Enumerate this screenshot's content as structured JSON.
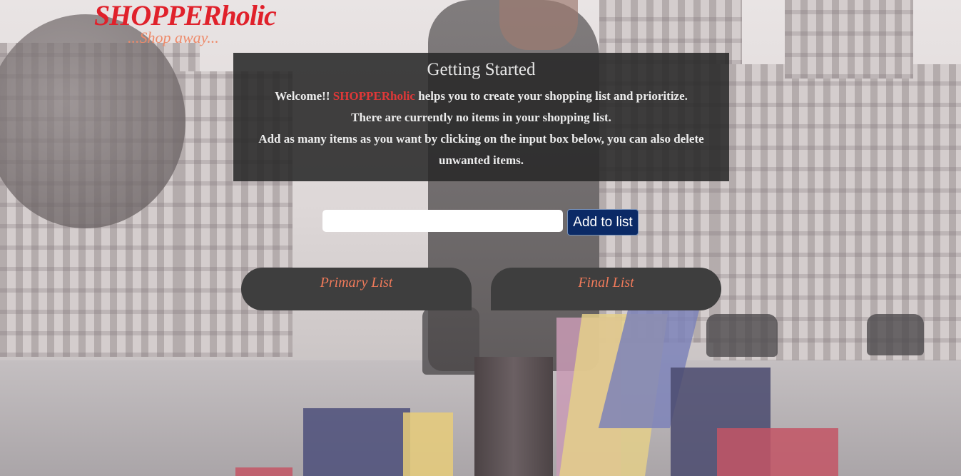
{
  "header": {
    "logo_title": "SHOPPERholic",
    "tagline": "...Shop away..."
  },
  "intro": {
    "heading": "Getting Started",
    "line1_prefix": "Welcome!!",
    "brand": "SHOPPERholic",
    "line1_suffix": "helps you to create your shopping list and prioritize.",
    "line2": "There are currently no items in your shopping list.",
    "line3": "Add as many items as you want by clicking on the input box below, you can also delete unwanted items."
  },
  "add_item": {
    "input_value": "",
    "input_placeholder": "",
    "button_label": "Add to list"
  },
  "lists": {
    "primary_label": "Primary List",
    "final_label": "Final List"
  },
  "colors": {
    "brand_red": "#e0212b",
    "tagline": "#ee8a6a",
    "panel_bg": "#282828",
    "button_bg": "#0b2a66",
    "tab_bg": "#3e3e3e",
    "tab_text": "#f07a5a"
  }
}
